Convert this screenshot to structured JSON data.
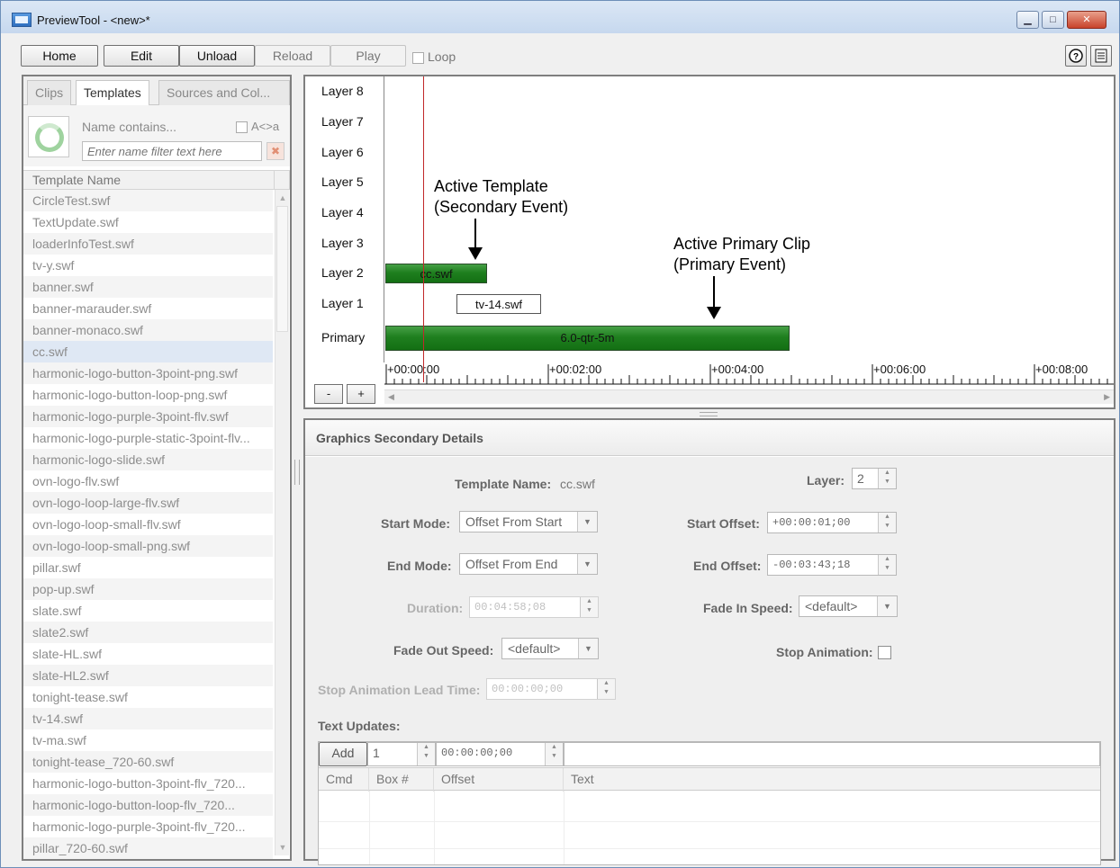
{
  "window": {
    "title": "PreviewTool - <new>*"
  },
  "toolbar": {
    "home": "Home",
    "edit": "Edit",
    "unload": "Unload",
    "reload": "Reload",
    "play": "Play",
    "loop": "Loop",
    "help_icon": "help-icon",
    "notes_icon": "notes-icon"
  },
  "left": {
    "tabs": [
      "Clips",
      "Templates",
      "Sources and Col..."
    ],
    "active_tab": "Templates",
    "filter": {
      "label": "Name contains...",
      "case_label": "A<>a",
      "placeholder": "Enter name filter text here"
    },
    "list_header": "Template Name",
    "selected": "cc.swf",
    "templates": [
      "CircleTest.swf",
      "TextUpdate.swf",
      "loaderInfoTest.swf",
      "tv-y.swf",
      "banner.swf",
      "banner-marauder.swf",
      "banner-monaco.swf",
      "cc.swf",
      "harmonic-logo-button-3point-png.swf",
      "harmonic-logo-button-loop-png.swf",
      "harmonic-logo-purple-3point-flv.swf",
      "harmonic-logo-purple-static-3point-flv...",
      "harmonic-logo-slide.swf",
      "ovn-logo-flv.swf",
      "ovn-logo-loop-large-flv.swf",
      "ovn-logo-loop-small-flv.swf",
      "ovn-logo-loop-small-png.swf",
      "pillar.swf",
      "pop-up.swf",
      "slate.swf",
      "slate2.swf",
      "slate-HL.swf",
      "slate-HL2.swf",
      "tonight-tease.swf",
      "tv-14.swf",
      "tv-ma.swf",
      "tonight-tease_720-60.swf",
      "harmonic-logo-button-3point-flv_720...",
      "harmonic-logo-button-loop-flv_720...",
      "harmonic-logo-purple-3point-flv_720...",
      "pillar_720-60.swf"
    ]
  },
  "timeline": {
    "layers": [
      "Layer 8",
      "Layer 7",
      "Layer 6",
      "Layer 5",
      "Layer 4",
      "Layer 3",
      "Layer 2",
      "Layer 1",
      "Primary"
    ],
    "clips": {
      "layer2": "cc.swf",
      "layer1": "tv-14.swf",
      "primary": "6.0-qtr-5m"
    },
    "annotations": {
      "template_line1": "Active Template",
      "template_line2": "(Secondary Event)",
      "primary_line1": "Active Primary Clip",
      "primary_line2": "(Primary Event)"
    },
    "ruler": [
      "+00:00:00",
      "+00:02:00",
      "+00:04:00",
      "+00:06:00",
      "+00:08:00"
    ],
    "zoom_out": "-",
    "zoom_in": "+"
  },
  "details": {
    "title": "Graphics Secondary Details",
    "template_name_label": "Template Name:",
    "template_name_value": "cc.swf",
    "layer_label": "Layer:",
    "layer_value": "2",
    "start_mode_label": "Start Mode:",
    "start_mode_value": "Offset From Start",
    "start_offset_label": "Start Offset:",
    "start_offset_value": "+00:00:01;00",
    "end_mode_label": "End Mode:",
    "end_mode_value": "Offset From End",
    "end_offset_label": "End Offset:",
    "end_offset_value": "-00:03:43;18",
    "duration_label": "Duration:",
    "duration_value": "00:04:58;08",
    "fade_in_label": "Fade In Speed:",
    "fade_in_value": "<default>",
    "fade_out_label": "Fade Out Speed:",
    "fade_out_value": "<default>",
    "stop_anim_label": "Stop Animation:",
    "stop_lead_label": "Stop Animation Lead Time:",
    "stop_lead_value": "00:00:00;00",
    "text_updates_label": "Text Updates:",
    "add_label": "Add",
    "box_value": "1",
    "offset_value": "00:00:00;00",
    "columns": [
      "Cmd",
      "Box #",
      "Offset",
      "Text"
    ]
  }
}
